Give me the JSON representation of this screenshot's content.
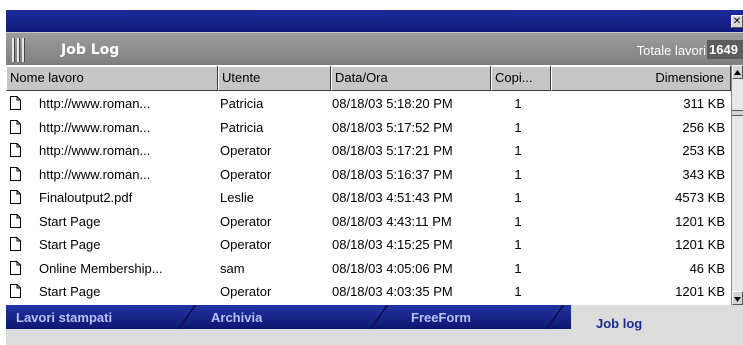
{
  "window": {
    "close_glyph": "✕"
  },
  "header": {
    "title": "Job Log",
    "total_label": "Totale lavori",
    "total_value": "1649"
  },
  "columns": [
    "Nome lavoro",
    "Utente",
    "Data/Ora",
    "Copi...",
    "Dimensione"
  ],
  "rows": [
    [
      "http://www.roman...",
      "Patricia",
      "08/18/03 5:18:20 PM",
      "1",
      "311 KB"
    ],
    [
      "http://www.roman...",
      "Patricia",
      "08/18/03 5:17:52 PM",
      "1",
      "256 KB"
    ],
    [
      "http://www.roman...",
      "Operator",
      "08/18/03 5:17:21 PM",
      "1",
      "253 KB"
    ],
    [
      "http://www.roman...",
      "Operator",
      "08/18/03 5:16:37 PM",
      "1",
      "343 KB"
    ],
    [
      "Finaloutput2.pdf",
      "Leslie",
      "08/18/03 4:51:43 PM",
      "1",
      "4573 KB"
    ],
    [
      "Start Page",
      "Operator",
      "08/18/03 4:43:11 PM",
      "1",
      "1201 KB"
    ],
    [
      "Start Page",
      "Operator",
      "08/18/03 4:15:25 PM",
      "1",
      "1201 KB"
    ],
    [
      "Online Membership...",
      "sam",
      "08/18/03 4:05:06 PM",
      "1",
      "46 KB"
    ],
    [
      "Start Page",
      "Operator",
      "08/18/03 4:03:35 PM",
      "1",
      "1201 KB"
    ]
  ],
  "tabs": [
    "Lavori stampati",
    "Archivia",
    "FreeForm",
    "Job log"
  ],
  "active_tab": "Job log",
  "colors": {
    "title_blue": "#101a78",
    "header_grey": "#8a8a8a",
    "tab_text": "#b8c0ff"
  }
}
